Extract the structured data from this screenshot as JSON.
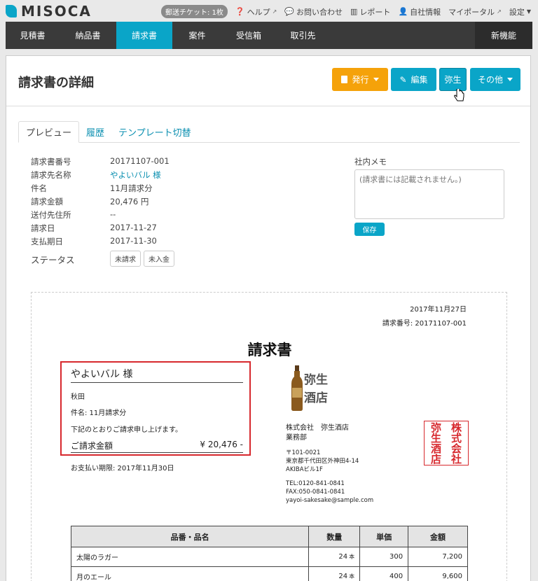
{
  "brand": {
    "name": "MISOCA"
  },
  "toplinks": {
    "ticket": "郵送チケット: 1枚",
    "help": "ヘルプ",
    "contact": "お問い合わせ",
    "report": "レポート",
    "company": "自社情報",
    "myportal": "マイポータル",
    "settings": "設定"
  },
  "nav": {
    "items": [
      "見積書",
      "納品書",
      "請求書",
      "案件",
      "受信箱",
      "取引先"
    ],
    "active": "請求書",
    "new_features": "新機能"
  },
  "header": {
    "title": "請求書の詳細",
    "issue_label": "発行",
    "edit_label": "編集",
    "yayoi_label": "弥生",
    "other_label": "その他"
  },
  "tabs": [
    "プレビュー",
    "履歴",
    "テンプレート切替"
  ],
  "details": {
    "invoice_no_label": "請求書番号",
    "invoice_no": "20171107-001",
    "client_label": "請求先名称",
    "client": "やよいバル 様",
    "subject_label": "件名",
    "subject": "11月請求分",
    "amount_label": "請求金額",
    "amount": "20,476 円",
    "address_label": "送付先住所",
    "address": "--",
    "date_label": "請求日",
    "date": "2017-11-27",
    "due_label": "支払期日",
    "due": "2017-11-30",
    "status_label": "ステータス",
    "status_unbilled": "未請求",
    "status_unpaid": "未入金"
  },
  "memo": {
    "label": "社内メモ",
    "placeholder": "(請求書には記載されません。)",
    "save_label": "保存"
  },
  "invoice": {
    "date": "2017年11月27日",
    "number": "請求番号: 20171107-001",
    "title": "請求書",
    "customer": "やよいバル 様",
    "customer_city": "秋田",
    "subject": "件名: 11月請求分",
    "message": "下記のとおりご請求申し上げます。",
    "total_label": "ご請求金額",
    "total_value": "¥ 20,476 -",
    "due": "お支払い期限: 2017年11月30日",
    "logo_text": "弥生酒店",
    "company_name": "株式会社　弥生酒店",
    "department": "業務部",
    "postal": "〒101-0021",
    "address1": "東京都千代田区外神田4-14",
    "address2": "AKIBAビル1F",
    "tel": "TEL:0120-841-0841",
    "fax": "FAX:050-0841-0841",
    "email": "yayoi-sakesake@sample.com",
    "seal_text": "株式会社弥生酒店"
  },
  "items": {
    "headers": [
      "品番・品名",
      "数量",
      "単価",
      "金額"
    ],
    "rows": [
      {
        "name": "太陽のラガー",
        "qty": "24",
        "unit": "本",
        "price": "300",
        "amount": "7,200"
      },
      {
        "name": "月のエール",
        "qty": "24",
        "unit": "本",
        "price": "400",
        "amount": "9,600"
      }
    ]
  }
}
